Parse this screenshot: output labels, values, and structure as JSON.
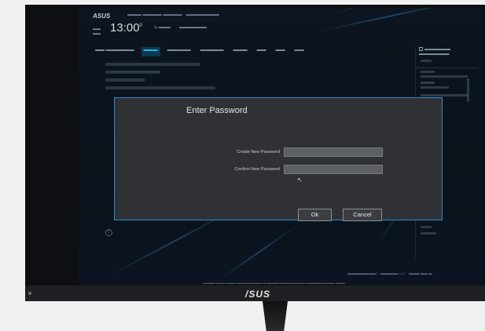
{
  "bios": {
    "brand": "ASUS",
    "time": "13:00",
    "time_degree": "0"
  },
  "tabs": [
    {
      "label": "",
      "active": false
    },
    {
      "label": "",
      "active": true
    },
    {
      "label": "",
      "active": false
    },
    {
      "label": "",
      "active": false
    },
    {
      "label": "",
      "active": false
    },
    {
      "label": "",
      "active": false
    },
    {
      "label": "",
      "active": false
    }
  ],
  "dialog": {
    "title": "Enter Password",
    "fields": [
      {
        "label": "Create New Password",
        "value": ""
      },
      {
        "label": "Confirm New Password",
        "value": ""
      }
    ],
    "ok_label": "Ok",
    "cancel_label": "Cancel"
  },
  "monitor": {
    "logo": "/SUS"
  },
  "colors": {
    "dialog_border": "#2d8fcf",
    "dialog_bg": "#2f3134",
    "active_tab": "#3fb6e8"
  }
}
